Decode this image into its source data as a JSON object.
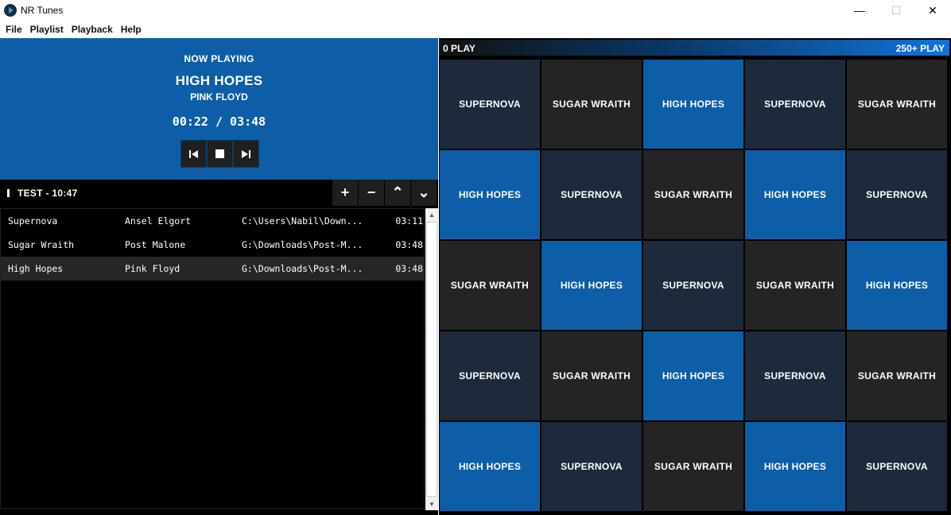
{
  "window": {
    "title": "NR Tunes",
    "minimize": "—",
    "maximize": "☐",
    "close": "✕"
  },
  "menu": [
    "File",
    "Playlist",
    "Playback",
    "Help"
  ],
  "now_playing": {
    "label": "NOW PLAYING",
    "title": "HIGH HOPES",
    "artist": "PINK FLOYD",
    "time": "00:22 / 03:48"
  },
  "playlist": {
    "name": "TEST - 10:47",
    "actions": [
      "+",
      "−",
      "⌃",
      "⌄"
    ],
    "rows": [
      {
        "title": "Supernova",
        "artist": "Ansel Elgort",
        "path": "C:\\Users\\Nabil\\Down...",
        "duration": "03:11"
      },
      {
        "title": "Sugar Wraith",
        "artist": "Post Malone",
        "path": "G:\\Downloads\\Post-M...",
        "duration": "03:48"
      },
      {
        "title": "High Hopes",
        "artist": "Pink Floyd",
        "path": "G:\\Downloads\\Post-M...",
        "duration": "03:48"
      }
    ],
    "selected_index": 2
  },
  "play_bar": {
    "left": "0 PLAY",
    "right": "250+ PLAY"
  },
  "tiles": [
    {
      "label": "SUPERNOVA",
      "color": "#1c2a3b"
    },
    {
      "label": "SUGAR WRAITH",
      "color": "#242424"
    },
    {
      "label": "HIGH HOPES",
      "color": "#0d5ea6"
    },
    {
      "label": "SUPERNOVA",
      "color": "#1c2a3b"
    },
    {
      "label": "SUGAR WRAITH",
      "color": "#242424"
    },
    {
      "label": "HIGH HOPES",
      "color": "#0d5ea6"
    },
    {
      "label": "SUPERNOVA",
      "color": "#1c2a3b"
    },
    {
      "label": "SUGAR WRAITH",
      "color": "#242424"
    },
    {
      "label": "HIGH HOPES",
      "color": "#0d5ea6"
    },
    {
      "label": "SUPERNOVA",
      "color": "#1c2a3b"
    },
    {
      "label": "SUGAR WRAITH",
      "color": "#242424"
    },
    {
      "label": "HIGH HOPES",
      "color": "#0d5ea6"
    },
    {
      "label": "SUPERNOVA",
      "color": "#1c2a3b"
    },
    {
      "label": "SUGAR WRAITH",
      "color": "#242424"
    },
    {
      "label": "HIGH HOPES",
      "color": "#0d5ea6"
    },
    {
      "label": "SUPERNOVA",
      "color": "#1c2a3b"
    },
    {
      "label": "SUGAR WRAITH",
      "color": "#242424"
    },
    {
      "label": "HIGH HOPES",
      "color": "#0d5ea6"
    },
    {
      "label": "SUPERNOVA",
      "color": "#1c2a3b"
    },
    {
      "label": "SUGAR WRAITH",
      "color": "#242424"
    },
    {
      "label": "HIGH HOPES",
      "color": "#0d5ea6"
    },
    {
      "label": "SUPERNOVA",
      "color": "#1c2a3b"
    },
    {
      "label": "SUGAR WRAITH",
      "color": "#242424"
    },
    {
      "label": "HIGH HOPES",
      "color": "#0d5ea6"
    },
    {
      "label": "SUPERNOVA",
      "color": "#1c2a3b"
    }
  ],
  "colors": {
    "accent_blue": "#0d5ea6",
    "tile_navy": "#1c2a3b",
    "tile_dark": "#242424"
  }
}
